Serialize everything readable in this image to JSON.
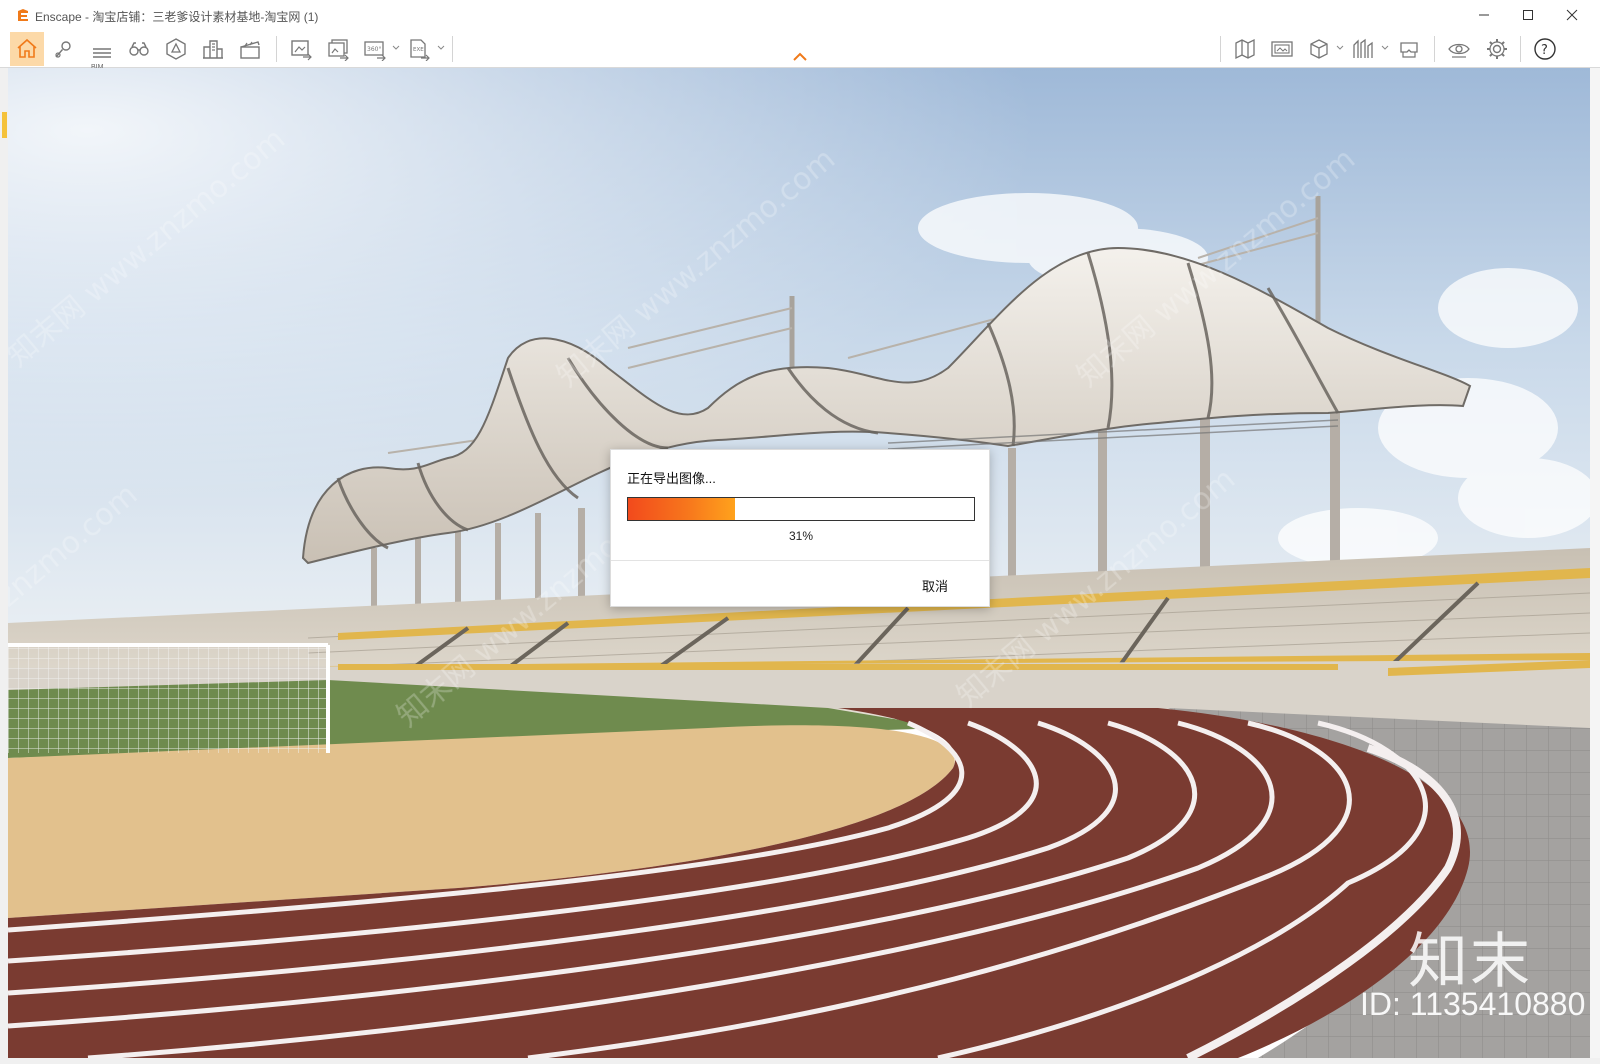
{
  "window": {
    "title": "Enscape - 淘宝店铺：三老爹设计素材基地-淘宝网 (1)",
    "minimize_icon": "minimize-icon",
    "maximize_icon": "maximize-icon",
    "close_icon": "close-icon"
  },
  "toolbar": {
    "left_buttons": [
      {
        "name": "home-icon",
        "active": true
      },
      {
        "name": "location-pin-icon"
      },
      {
        "name": "bim-list-icon",
        "label": "BIM"
      },
      {
        "name": "binoculars-icon"
      },
      {
        "name": "asset-library-icon"
      },
      {
        "name": "buildings-icon"
      },
      {
        "name": "clapperboard-icon"
      }
    ],
    "export_buttons": [
      {
        "name": "screenshot-export-icon"
      },
      {
        "name": "batch-render-icon"
      },
      {
        "name": "panorama-360-icon",
        "label": "360°"
      },
      {
        "name": "exe-export-icon",
        "label": "EXE"
      }
    ],
    "right_buttons": [
      {
        "name": "map-icon"
      },
      {
        "name": "image-view-icon"
      },
      {
        "name": "cube-view-icon"
      },
      {
        "name": "sync-views-icon"
      },
      {
        "name": "vr-headset-icon"
      },
      {
        "name": "eye-visibility-icon"
      },
      {
        "name": "settings-gear-icon"
      },
      {
        "name": "help-icon",
        "label": "?"
      }
    ],
    "accent_color": "#fcd9a8",
    "chevron_color": "#f07a1a"
  },
  "dialog": {
    "title": "正在导出图像...",
    "progress": 0.31,
    "progress_label": "31%",
    "cancel_label": "取消",
    "progress_colors": [
      "#f24a1c",
      "#ffa21c"
    ]
  },
  "watermark": {
    "logo_text": "知末",
    "id_text": "ID: 1135410880"
  }
}
